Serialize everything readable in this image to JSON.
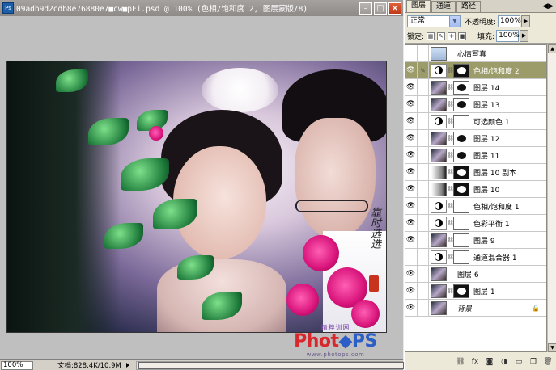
{
  "document": {
    "title": "09adb9d2cdb8e76880e7■cw■pFi.psd @ 100% (色相/饱和度 2, 图层蒙版/8)",
    "app_icon": "Ps",
    "minimize": "–",
    "maximize": "□",
    "close": "×"
  },
  "photo": {
    "signature": "靠时选选"
  },
  "watermark": {
    "top": "精粹训网",
    "logo_part1": "Phot",
    "logo_part2": "◆PS",
    "url": "www.photops.com"
  },
  "status": {
    "zoom": "100%",
    "doc_info": "文档:828.4K/10.9M"
  },
  "panel": {
    "tabs": [
      {
        "label": "图层"
      },
      {
        "label": "通道"
      },
      {
        "label": "路径"
      }
    ],
    "menu": "◀▶",
    "blend_mode": "正常",
    "opacity_label": "不透明度:",
    "opacity_value": "100%",
    "lock_label": "锁定:",
    "fill_label": "填充:",
    "fill_value": "100%",
    "go": "▶"
  },
  "layers": [
    {
      "name": "心情写真",
      "eye": "",
      "brush": "",
      "thumb": "group",
      "chain": "",
      "mask": "",
      "italic": false
    },
    {
      "name": "色相/饱和度 2",
      "eye": "👁",
      "brush": "✎",
      "thumb": "adj",
      "chain": "⛓",
      "mask": "blackwhite",
      "italic": false,
      "active": true
    },
    {
      "name": "图层 14",
      "eye": "👁",
      "brush": "",
      "thumb": "photo",
      "chain": "⛓",
      "mask": "spots",
      "italic": false
    },
    {
      "name": "图层 13",
      "eye": "👁",
      "brush": "",
      "thumb": "photo",
      "chain": "⛓",
      "mask": "spots",
      "italic": false
    },
    {
      "name": "可选颜色 1",
      "eye": "👁",
      "brush": "",
      "thumb": "adj",
      "chain": "⛓",
      "mask": "white",
      "italic": false
    },
    {
      "name": "图层 12",
      "eye": "👁",
      "brush": "",
      "thumb": "photo",
      "chain": "⛓",
      "mask": "spots",
      "italic": false
    },
    {
      "name": "图层 11",
      "eye": "👁",
      "brush": "",
      "thumb": "photo",
      "chain": "⛓",
      "mask": "spots",
      "italic": false
    },
    {
      "name": "图层 10 副本",
      "eye": "👁",
      "brush": "",
      "thumb": "grad",
      "chain": "⛓",
      "mask": "black",
      "italic": false
    },
    {
      "name": "图层 10",
      "eye": "👁",
      "brush": "",
      "thumb": "grad",
      "chain": "⛓",
      "mask": "black",
      "italic": false
    },
    {
      "name": "色相/饱和度 1",
      "eye": "👁",
      "brush": "",
      "thumb": "adj",
      "chain": "⛓",
      "mask": "white",
      "italic": false
    },
    {
      "name": "色彩平衡 1",
      "eye": "👁",
      "brush": "",
      "thumb": "adj",
      "chain": "⛓",
      "mask": "white",
      "italic": false
    },
    {
      "name": "图层 9",
      "eye": "👁",
      "brush": "",
      "thumb": "photo",
      "chain": "⛓",
      "mask": "white",
      "italic": false
    },
    {
      "name": "通道混合器 1",
      "eye": "",
      "brush": "",
      "thumb": "adj",
      "chain": "⛓",
      "mask": "white",
      "italic": false
    },
    {
      "name": "图层 6",
      "eye": "👁",
      "brush": "",
      "thumb": "photo",
      "chain": "",
      "mask": "",
      "italic": false
    },
    {
      "name": "图层 1",
      "eye": "👁",
      "brush": "",
      "thumb": "photo",
      "chain": "⛓",
      "mask": "black",
      "italic": false
    },
    {
      "name": "背景",
      "eye": "👁",
      "brush": "",
      "thumb": "photo",
      "chain": "",
      "mask": "",
      "italic": true,
      "locked": "🔒"
    }
  ],
  "panel_bottom": {
    "buttons": [
      {
        "icon": "link-icon",
        "glyph": "⛓"
      },
      {
        "icon": "fx-icon",
        "glyph": "fx"
      },
      {
        "icon": "mask-icon",
        "glyph": "◙"
      },
      {
        "icon": "adjustment-icon",
        "glyph": "◑"
      },
      {
        "icon": "folder-icon",
        "glyph": "▭"
      },
      {
        "icon": "new-layer-icon",
        "glyph": "❐"
      },
      {
        "icon": "trash-icon",
        "glyph": "🗑"
      }
    ]
  }
}
